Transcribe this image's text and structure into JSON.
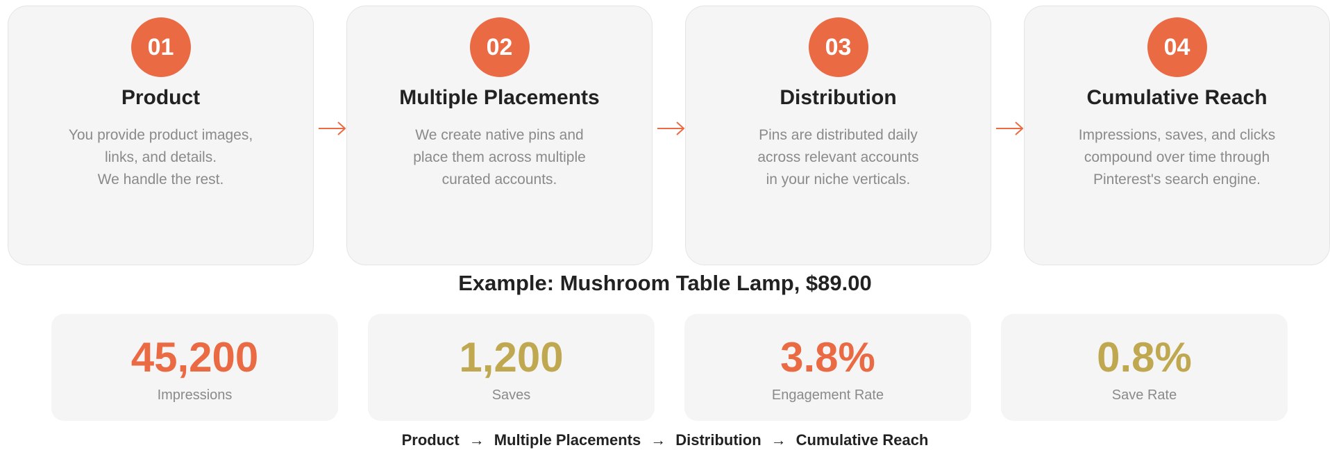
{
  "steps": [
    {
      "number": "01",
      "title": "Product",
      "description": [
        "You provide product images,",
        "links, and details.",
        "We handle the rest."
      ]
    },
    {
      "number": "02",
      "title": "Multiple Placements",
      "description": [
        "We create native pins and",
        "place them across multiple",
        "curated accounts."
      ]
    },
    {
      "number": "03",
      "title": "Distribution",
      "description": [
        "Pins are distributed daily",
        "across relevant accounts",
        "in your niche verticals."
      ]
    },
    {
      "number": "04",
      "title": "Cumulative Reach",
      "description": [
        "Impressions, saves, and clicks",
        "compound over time through",
        "Pinterest's search engine."
      ]
    }
  ],
  "example": {
    "title": "Example: Mushroom Table Lamp, $89.00"
  },
  "stats": [
    {
      "value": "45,200",
      "label": "Impressions",
      "color": "#ea6a43"
    },
    {
      "value": "1,200",
      "label": "Saves",
      "color": "#bfa84f"
    },
    {
      "value": "3.8%",
      "label": "Engagement Rate",
      "color": "#ea6a43"
    },
    {
      "value": "0.8%",
      "label": "Save Rate",
      "color": "#bfa84f"
    }
  ],
  "flow": {
    "items": [
      "Product",
      "Multiple Placements",
      "Distribution",
      "Cumulative Reach"
    ],
    "separator": "→"
  },
  "colors": {
    "accent": "#ea6a43",
    "accent_secondary": "#bfa84f"
  }
}
